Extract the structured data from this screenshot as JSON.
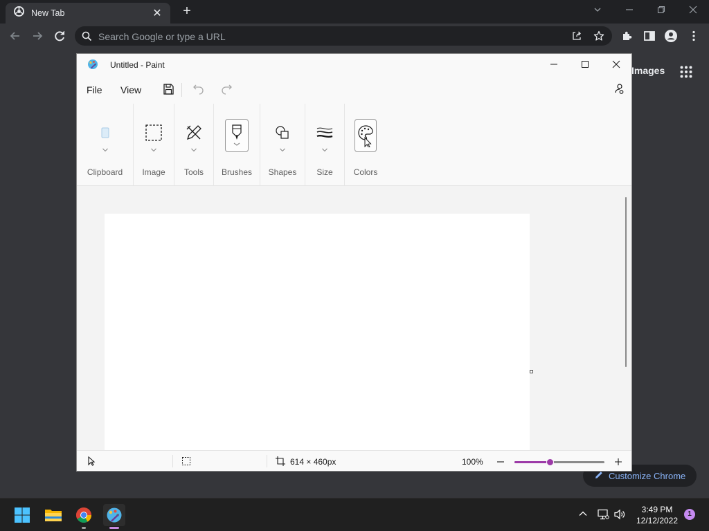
{
  "browser": {
    "tab": {
      "title": "New Tab",
      "icon": "chrome-logo-icon"
    },
    "omnibox": {
      "placeholder": "Search Google or type a URL"
    },
    "content": {
      "images_link": "Images",
      "customize_label": "Customize Chrome"
    }
  },
  "paint": {
    "title": "Untitled - Paint",
    "menu": {
      "file": "File",
      "view": "View"
    },
    "ribbon": [
      {
        "label": "Clipboard",
        "icon": "clipboard-icon"
      },
      {
        "label": "Image",
        "icon": "selection-icon"
      },
      {
        "label": "Tools",
        "icon": "tools-icon"
      },
      {
        "label": "Brushes",
        "icon": "brush-icon"
      },
      {
        "label": "Shapes",
        "icon": "shapes-icon"
      },
      {
        "label": "Size",
        "icon": "stroke-size-icon"
      },
      {
        "label": "Colors",
        "icon": "palette-icon"
      }
    ],
    "status": {
      "canvas_size": "614 × 460px",
      "zoom_label": "100%",
      "zoom_level": 0.4
    }
  },
  "taskbar": {
    "apps": [
      "start-icon",
      "file-explorer-icon",
      "chrome-icon",
      "paint-icon"
    ],
    "clock": {
      "time": "3:49 PM",
      "date": "12/12/2022"
    },
    "notification_count": "1"
  },
  "colors": {
    "accent": "#9c3aa7",
    "chrome_bg": "#35363a",
    "link": "#8ab4f8"
  }
}
